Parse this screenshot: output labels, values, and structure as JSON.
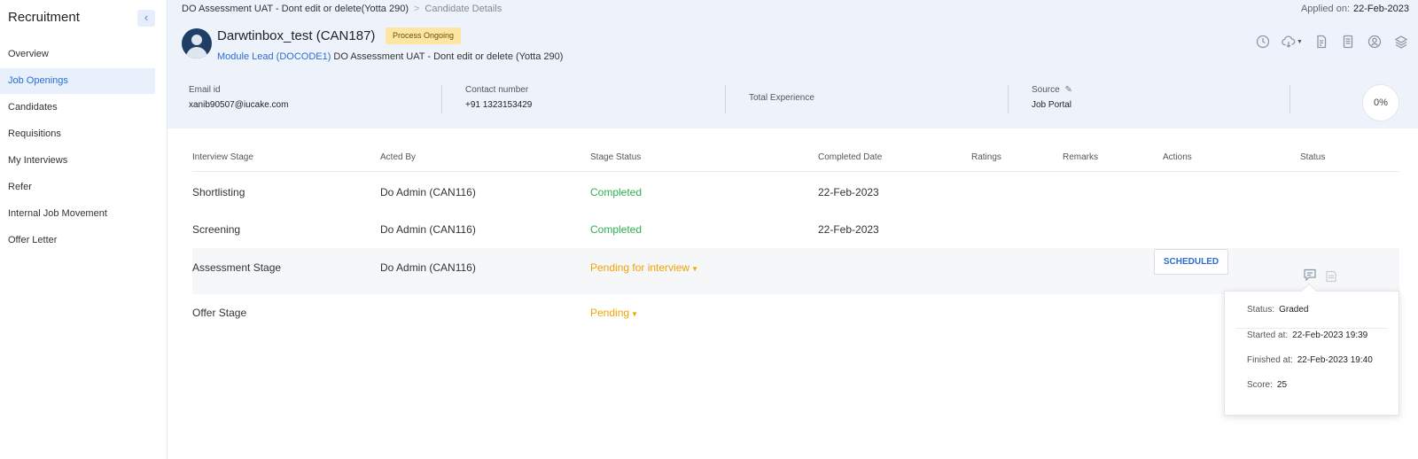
{
  "sidebar": {
    "title": "Recruitment",
    "collapse_icon": "‹",
    "items": [
      {
        "label": "Overview",
        "active": false
      },
      {
        "label": "Job Openings",
        "active": true
      },
      {
        "label": "Candidates",
        "active": false
      },
      {
        "label": "Requisitions",
        "active": false
      },
      {
        "label": "My Interviews",
        "active": false
      },
      {
        "label": "Refer",
        "active": false
      },
      {
        "label": "Internal Job Movement",
        "active": false
      },
      {
        "label": "Offer Letter",
        "active": false
      }
    ]
  },
  "header": {
    "breadcrumb": {
      "parent": "DO Assessment UAT - Dont edit or delete(Yotta 290)",
      "separator": ">",
      "current": "Candidate Details"
    },
    "applied_label": "Applied on:",
    "applied_date": "22-Feb-2023",
    "candidate_name": "Darwtinbox_test (CAN187)",
    "status_badge": "Process Ongoing",
    "role_link": "Module Lead (DOCODE1)",
    "role_job": "DO Assessment UAT - Dont edit or delete (Yotta 290)",
    "icons": [
      "history-icon",
      "cloud-download-icon",
      "document-icon",
      "notes-icon",
      "user-circle-icon",
      "layers-icon"
    ],
    "info": {
      "email_label": "Email id",
      "email_value": "xanib90507@iucake.com",
      "contact_label": "Contact number",
      "contact_value": "+91 1323153429",
      "experience_label": "Total Experience",
      "source_label": "Source",
      "source_value": "Job Portal"
    },
    "completion": "0%"
  },
  "table": {
    "columns": [
      "Interview Stage",
      "Acted By",
      "Stage Status",
      "Completed Date",
      "Ratings",
      "Remarks",
      "Actions",
      "Status"
    ],
    "rows": [
      {
        "stage": "Shortlisting",
        "acted_by": "Do Admin (CAN116)",
        "status": "Completed",
        "completed_date": "22-Feb-2023"
      },
      {
        "stage": "Screening",
        "acted_by": "Do Admin (CAN116)",
        "status": "Completed",
        "completed_date": "22-Feb-2023"
      },
      {
        "stage": "Assessment Stage",
        "acted_by": "Do Admin (CAN116)",
        "status": "Pending for interview",
        "completed_date": "",
        "action": "SCHEDULED"
      },
      {
        "stage": "Offer Stage",
        "acted_by": "",
        "status": "Pending",
        "completed_date": ""
      }
    ]
  },
  "popover": {
    "status_label": "Status:",
    "status_value": "Graded",
    "started_label": "Started at:",
    "started_value": "22-Feb-2023 19:39",
    "finished_label": "Finished at:",
    "finished_value": "22-Feb-2023 19:40",
    "score_label": "Score:",
    "score_value": "25"
  },
  "colors": {
    "accent": "#2a6dd4",
    "completed": "#2db050",
    "pending": "#f2a400",
    "header_bg": "#eef3fb",
    "badge_bg": "#fde5a4"
  }
}
